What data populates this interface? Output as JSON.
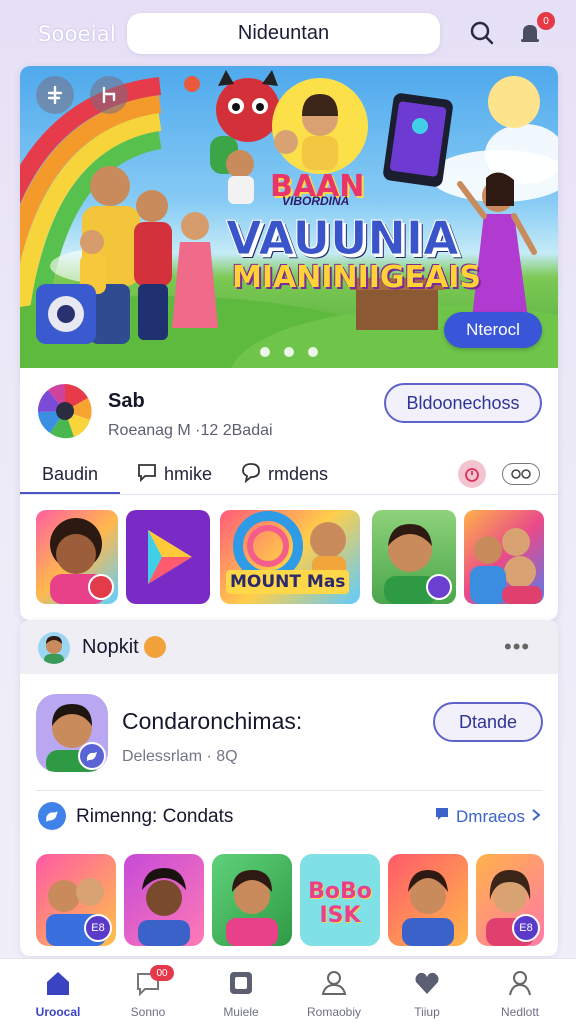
{
  "app": {
    "title": "Sooeial"
  },
  "search": {
    "value": "Nideuntan"
  },
  "notifications": {
    "badge": "0"
  },
  "hero": {
    "small_title": "BAAN",
    "kicker": "VIBORDINA",
    "big_title": "VAUUNIA",
    "subtitle": "MIANINIIGEAIS",
    "cta_label": "Nterocl"
  },
  "profile": {
    "name": "Sab",
    "subtitle": "Roeanag M ·12 2Badai",
    "follow_label": "Bldoonechoss"
  },
  "tabs": [
    {
      "label": "Baudin"
    },
    {
      "label": "hmike"
    },
    {
      "label": "rmdens"
    }
  ],
  "thumbs": {
    "mount_text": "MOUNT Mas"
  },
  "card2": {
    "title": "Nopkit",
    "contact_name": "Condaronchimas:",
    "contact_sub": "Delessrlam · 8Q",
    "action_label": "Dtande",
    "section_title": "Rimenng: Condats",
    "section_link": "Dmraeos",
    "thumb_badges": [
      "E8",
      "",
      "",
      "",
      "",
      "E8"
    ],
    "tile_text": "BoBo ISK"
  },
  "nav": {
    "items": [
      {
        "label": "Uroocal"
      },
      {
        "label": "Sonno"
      },
      {
        "label": "Muiele"
      },
      {
        "label": "Romaobiy"
      },
      {
        "label": "Tiiup"
      },
      {
        "label": "Nedlott"
      }
    ],
    "badge": "00"
  },
  "colors": {
    "accent": "#3a44c2",
    "badge": "#e53946",
    "button_border": "#5e63c9"
  }
}
